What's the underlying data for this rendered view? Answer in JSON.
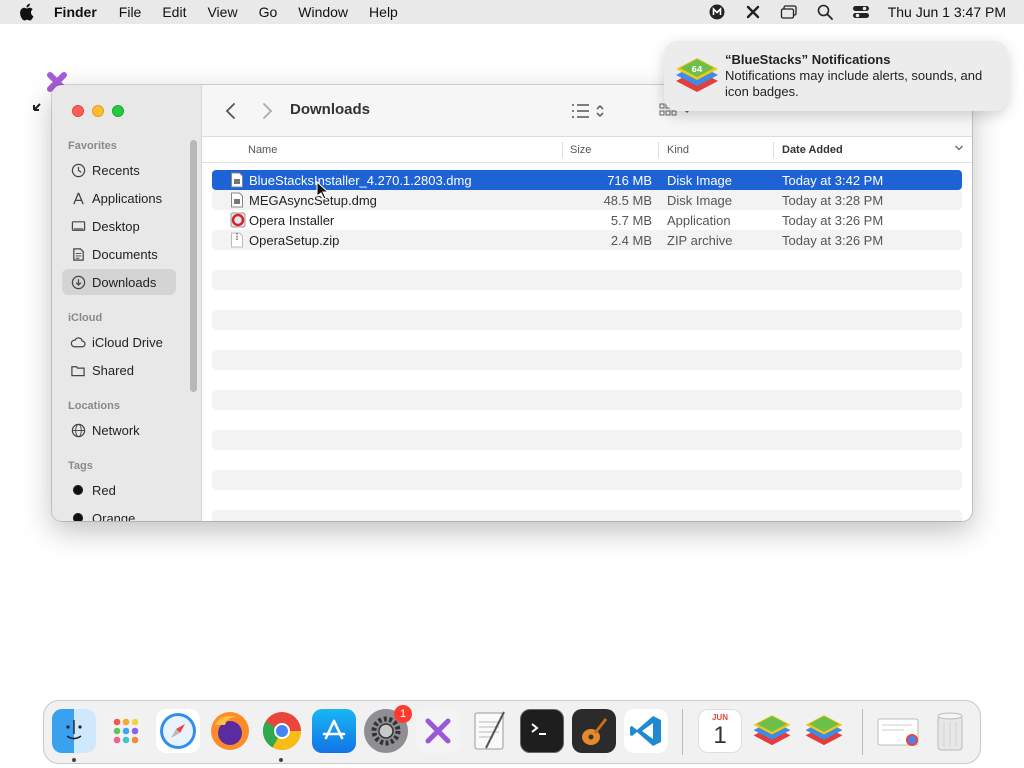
{
  "menubar": {
    "app_name": "Finder",
    "items": [
      "File",
      "Edit",
      "View",
      "Go",
      "Window",
      "Help"
    ],
    "clock": "Thu Jun 1  3:47 PM"
  },
  "window": {
    "title": "Downloads",
    "sidebar": {
      "favorites_header": "Favorites",
      "favorites": [
        "Recents",
        "Applications",
        "Desktop",
        "Documents",
        "Downloads"
      ],
      "icloud_header": "iCloud",
      "icloud": [
        "iCloud Drive",
        "Shared"
      ],
      "locations_header": "Locations",
      "locations": [
        "Network"
      ],
      "tags_header": "Tags",
      "tags": [
        {
          "label": "Red",
          "color": "#111111"
        },
        {
          "label": "Orange",
          "color": "#111111"
        }
      ]
    },
    "columns": {
      "name": "Name",
      "size": "Size",
      "kind": "Kind",
      "date": "Date Added"
    },
    "files": [
      {
        "name": "BlueStacksInstaller_4.270.1.2803.dmg",
        "size": "716 MB",
        "kind": "Disk Image",
        "date": "Today at 3:42 PM",
        "selected": true,
        "icon": "dmg-icon"
      },
      {
        "name": "MEGAsyncSetup.dmg",
        "size": "48.5 MB",
        "kind": "Disk Image",
        "date": "Today at 3:28 PM",
        "selected": false,
        "icon": "dmg-icon"
      },
      {
        "name": "Opera Installer",
        "size": "5.7 MB",
        "kind": "Application",
        "date": "Today at 3:26 PM",
        "selected": false,
        "icon": "opera-installer-icon"
      },
      {
        "name": "OperaSetup.zip",
        "size": "2.4 MB",
        "kind": "ZIP archive",
        "date": "Today at 3:26 PM",
        "selected": false,
        "icon": "zip-icon"
      }
    ]
  },
  "notification": {
    "title": "“BlueStacks” Notifications",
    "body": "Notifications may include alerts, sounds, and icon badges."
  },
  "dock": {
    "settings_badge": "1",
    "calendar_month": "JUN",
    "calendar_day": "1"
  },
  "colors": {
    "selection": "#1e63d6",
    "accent_red": "#ff5f57"
  }
}
